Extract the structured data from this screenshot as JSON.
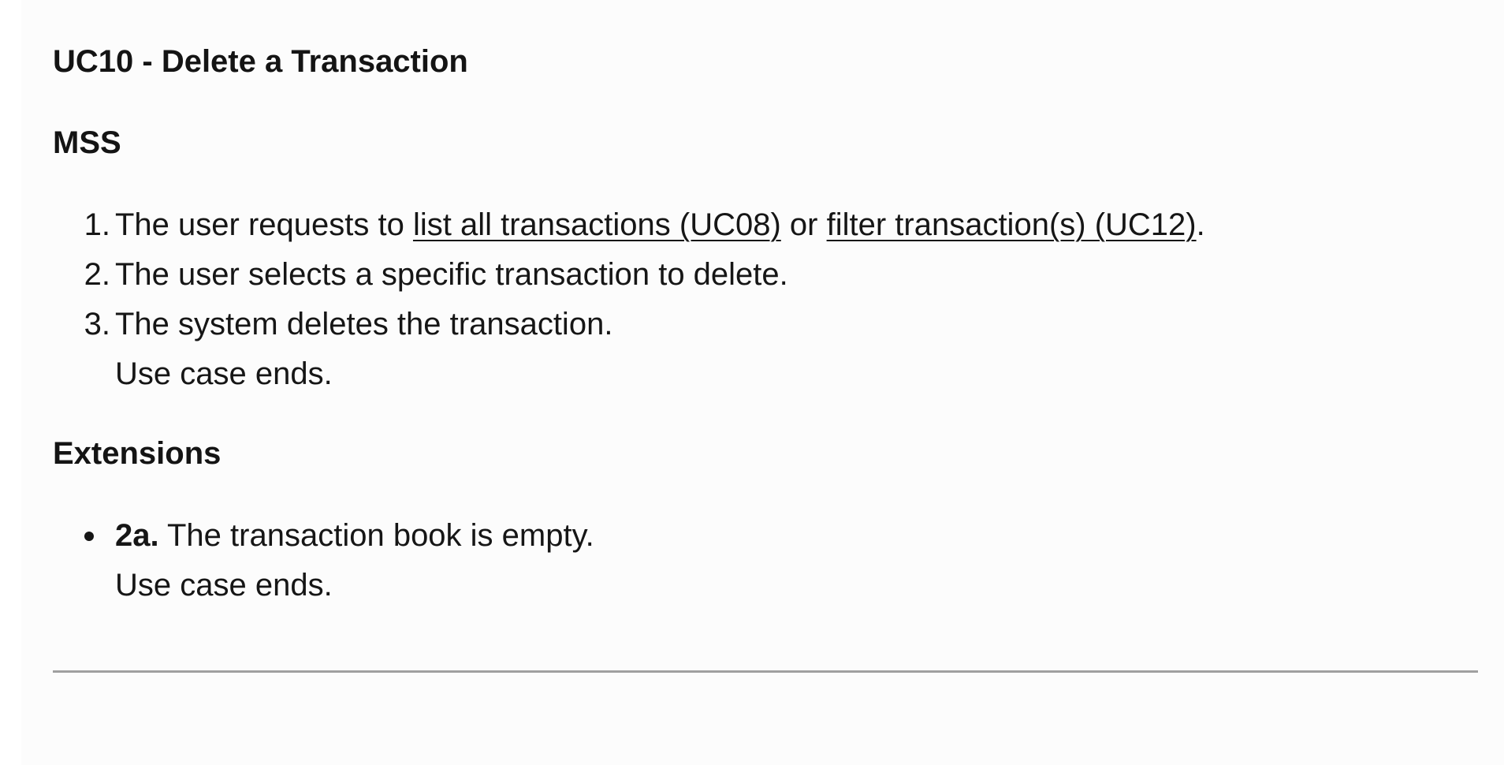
{
  "title": "UC10 - Delete a Transaction",
  "mss": {
    "heading": "MSS",
    "steps": [
      {
        "number": "1.",
        "text_before": "The user requests to ",
        "link1": "list all transactions (UC08)",
        "text_middle": " or ",
        "link2": "filter transaction(s) (UC12)",
        "text_after": "."
      },
      {
        "number": "2.",
        "text": "The user selects a specific transaction to delete."
      },
      {
        "number": "3.",
        "text": "The system deletes the transaction.",
        "subline": "Use case ends."
      }
    ]
  },
  "extensions": {
    "heading": "Extensions",
    "items": [
      {
        "label": "2a.",
        "text": " The transaction book is empty.",
        "subline": "Use case ends."
      }
    ]
  }
}
